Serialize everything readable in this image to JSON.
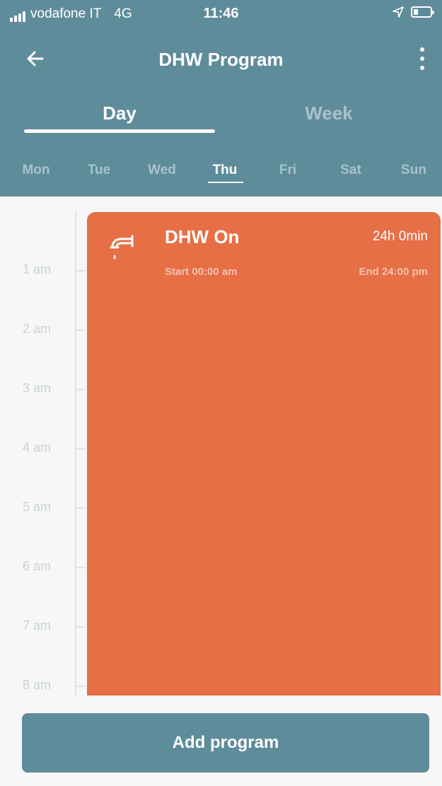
{
  "colors": {
    "header_bg": "#5f8c9a",
    "event_bg": "#e66f46",
    "inactive_tab": "#a8c2cb",
    "page_bg": "#f7f7f7"
  },
  "status_bar": {
    "carrier": "vodafone IT",
    "network": "4G",
    "time": "11:46",
    "icons": [
      "signal-icon",
      "location-arrow-icon",
      "battery-icon"
    ]
  },
  "header": {
    "title": "DHW Program",
    "back_icon": "arrow-left-icon",
    "menu_icon": "more-vertical-icon"
  },
  "tabs": [
    {
      "label": "Day",
      "active": true
    },
    {
      "label": "Week",
      "active": false
    }
  ],
  "days": [
    {
      "label": "Mon",
      "active": false
    },
    {
      "label": "Tue",
      "active": false
    },
    {
      "label": "Wed",
      "active": false
    },
    {
      "label": "Thu",
      "active": true
    },
    {
      "label": "Fri",
      "active": false
    },
    {
      "label": "Sat",
      "active": false
    },
    {
      "label": "Sun",
      "active": false
    }
  ],
  "timeline": {
    "hours": [
      "1 am",
      "2 am",
      "3 am",
      "4 am",
      "5 am",
      "6 am",
      "7 am",
      "8 am"
    ]
  },
  "event": {
    "icon": "faucet-icon",
    "title": "DHW On",
    "duration": "24h 0min",
    "start": "Start 00:00 am",
    "end": "End 24:00 pm"
  },
  "add_button": {
    "label": "Add program"
  }
}
